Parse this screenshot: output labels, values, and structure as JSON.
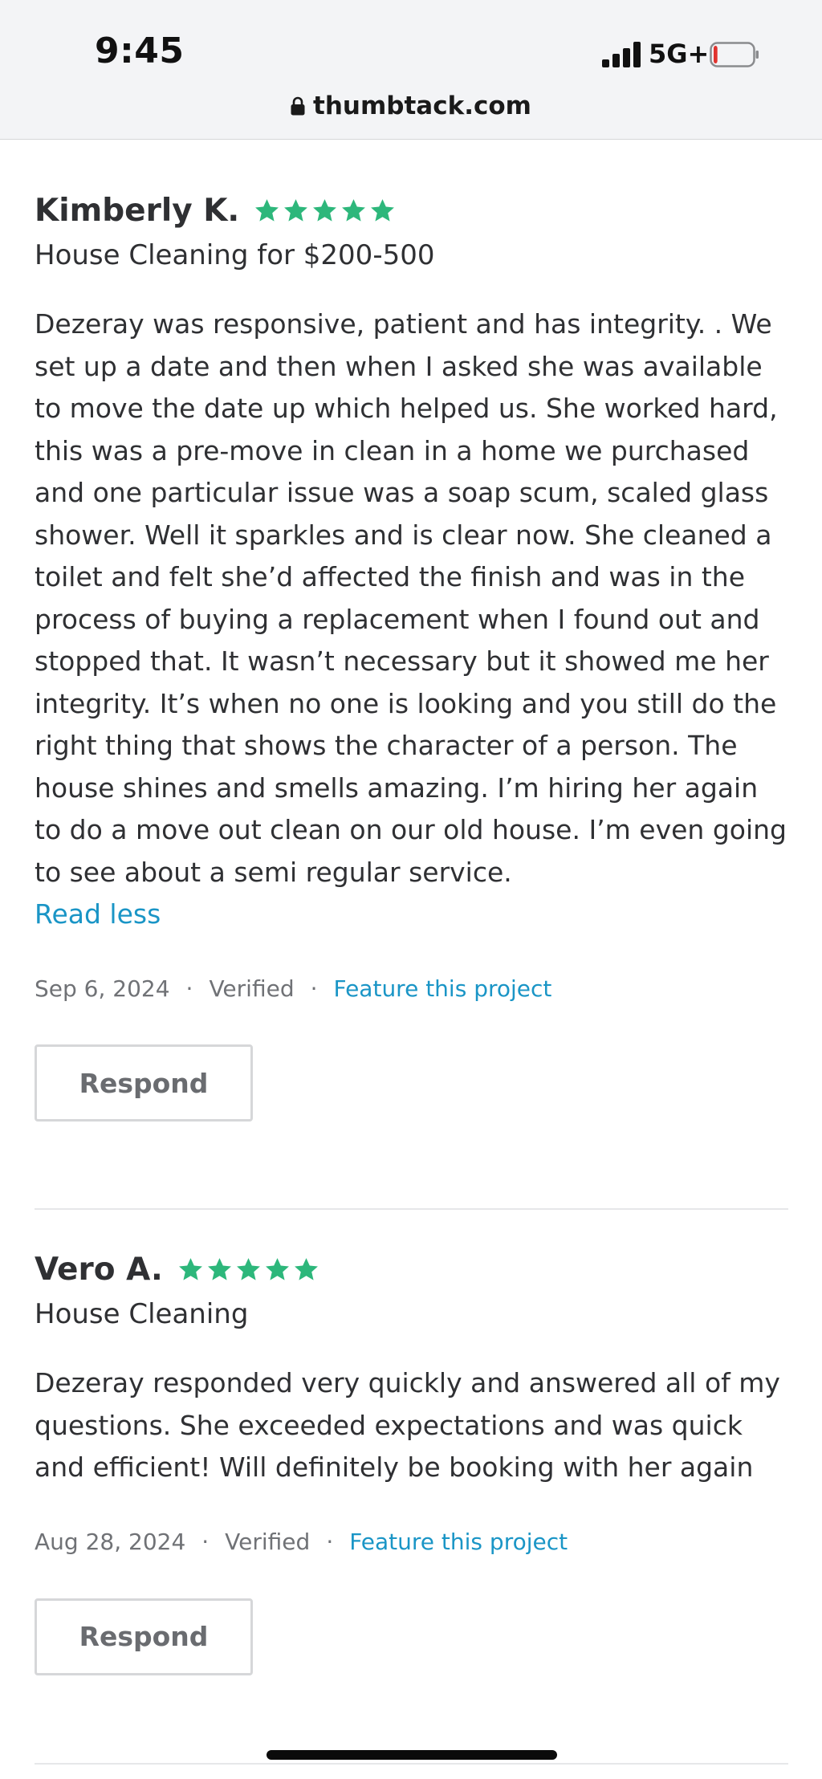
{
  "status_bar": {
    "time": "9:45",
    "network": "5G+",
    "battery_level": 0.1,
    "battery_color": "#e0332f"
  },
  "browser": {
    "url": "thumbtack.com"
  },
  "colors": {
    "star": "#2db77b",
    "link": "#1a95c6",
    "text": "#2f3033"
  },
  "reviews": [
    {
      "name": "Kimberly K.",
      "rating": 5,
      "service": "House Cleaning for $200-500",
      "text": "Dezeray was responsive, patient and has integrity. . We set up a date and then when I asked she was available to move the date up which helped us. She worked hard, this was a pre-move in clean in a home we purchased and one particular issue was a soap scum, scaled glass shower. Well it sparkles and is clear now. She cleaned a toilet and felt she’d affected the finish and was in the process of buying a replacement when I found out and stopped that. It wasn’t necessary but it showed me her integrity. It’s when no one is looking and you still do the right thing that shows the character of a person. The house shines and smells amazing. I’m hiring her again to do a move out clean on our old house. I’m even going to see about a semi regular service.",
      "read_toggle": "Read less",
      "date": "Sep 6, 2024",
      "verified": "Verified",
      "feature_link": "Feature this project",
      "respond_label": "Respond"
    },
    {
      "name": "Vero A.",
      "rating": 5,
      "service": "House Cleaning",
      "text": "Dezeray responded very quickly and answered all of my questions. She exceeded expectations and was quick and efficient! Will definitely be booking with her again",
      "date": "Aug 28, 2024",
      "verified": "Verified",
      "feature_link": "Feature this project",
      "respond_label": "Respond"
    }
  ],
  "separators": {
    "dot": "·"
  }
}
